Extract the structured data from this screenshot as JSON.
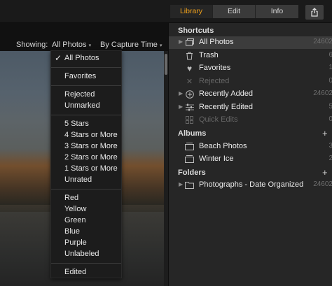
{
  "tabs": [
    {
      "label": "Library",
      "active": true
    },
    {
      "label": "Edit",
      "active": false
    },
    {
      "label": "Info",
      "active": false
    }
  ],
  "share_icon": "share-icon",
  "toolbar": {
    "showing_label": "Showing:",
    "showing_value": "All Photos",
    "sort_value": "By Capture Time"
  },
  "filter_menu": {
    "groups": [
      [
        {
          "label": "All Photos",
          "checked": true
        }
      ],
      [
        {
          "label": "Favorites"
        }
      ],
      [
        {
          "label": "Rejected"
        },
        {
          "label": "Unmarked"
        }
      ],
      [
        {
          "label": "5 Stars"
        },
        {
          "label": "4 Stars or More"
        },
        {
          "label": "3 Stars or More"
        },
        {
          "label": "2 Stars or More"
        },
        {
          "label": "1 Stars or More"
        },
        {
          "label": "Unrated"
        }
      ],
      [
        {
          "label": "Red"
        },
        {
          "label": "Yellow"
        },
        {
          "label": "Green"
        },
        {
          "label": "Blue"
        },
        {
          "label": "Purple"
        },
        {
          "label": "Unlabeled"
        }
      ],
      [
        {
          "label": "Edited"
        }
      ]
    ]
  },
  "sidebar": {
    "shortcuts_title": "Shortcuts",
    "shortcuts": [
      {
        "label": "All Photos",
        "count": "24602",
        "icon": "photos-icon",
        "selected": true,
        "arrow": true
      },
      {
        "label": "Trash",
        "count": "6",
        "icon": "trash-icon"
      },
      {
        "label": "Favorites",
        "count": "1",
        "icon": "heart-icon"
      },
      {
        "label": "Rejected",
        "count": "0",
        "icon": "x-icon",
        "dim": true
      },
      {
        "label": "Recently Added",
        "count": "24602",
        "icon": "plus-circle-icon",
        "arrow": true
      },
      {
        "label": "Recently Edited",
        "count": "5",
        "icon": "sliders-icon",
        "arrow": true
      },
      {
        "label": "Quick Edits",
        "count": "0",
        "icon": "grid-icon",
        "dim": true
      }
    ],
    "albums_title": "Albums",
    "albums": [
      {
        "label": "Beach Photos",
        "count": "3",
        "icon": "album-icon"
      },
      {
        "label": "Winter Ice",
        "count": "2",
        "icon": "album-icon"
      }
    ],
    "folders_title": "Folders",
    "folders": [
      {
        "label": "Photographs - Date Organized",
        "count": "24602",
        "icon": "folder-icon",
        "arrow": true
      }
    ]
  }
}
